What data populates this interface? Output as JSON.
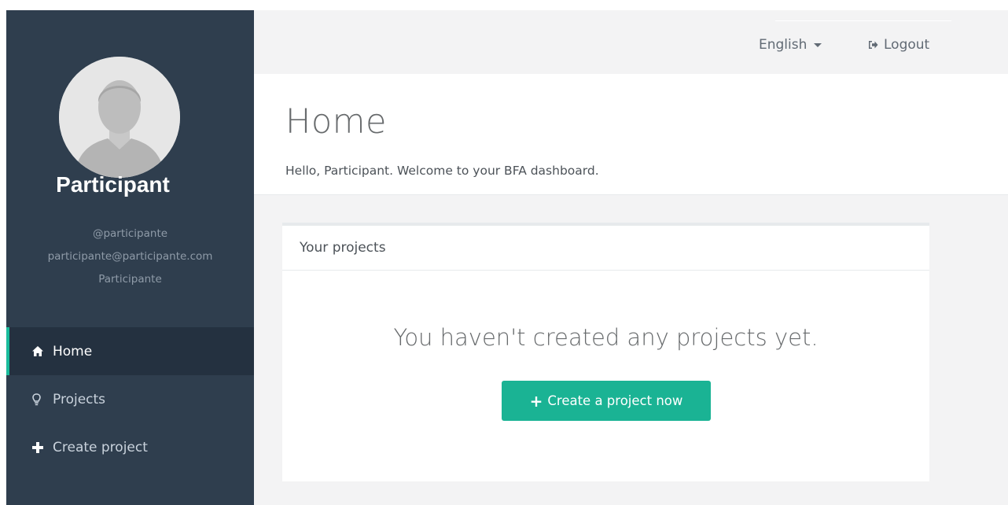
{
  "user": {
    "name": "Participant",
    "username": "@participante",
    "email": "participante@participante.com",
    "role": "Participante"
  },
  "nav": {
    "items": [
      {
        "label": "Home",
        "icon": "home-icon",
        "active": true
      },
      {
        "label": "Projects",
        "icon": "lightbulb-icon",
        "active": false
      },
      {
        "label": "Create project",
        "icon": "plus-icon",
        "active": false
      }
    ]
  },
  "topbar": {
    "language": "English",
    "logout_label": "Logout"
  },
  "header": {
    "title": "Home",
    "subtitle": "Hello, Participant. Welcome to your BFA dashboard."
  },
  "projects_panel": {
    "heading": "Your projects",
    "empty_message": "You haven't created any projects yet.",
    "create_button_label": "Create a project now"
  },
  "colors": {
    "sidebar_bg": "#2f3e4e",
    "accent": "#1ab394",
    "active_border": "#1abc9c"
  }
}
